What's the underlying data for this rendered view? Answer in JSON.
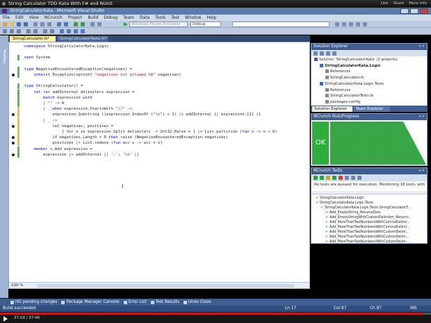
{
  "video": {
    "title": "String Calculator TDD Kata With F# and NUnit",
    "header_right": [
      "Like",
      "Share",
      "More info"
    ],
    "time_current": "37:09",
    "time_total": "37:46",
    "progress": 0.98
  },
  "window": {
    "title": "StringCalculatorKata - Microsoft Visual Studio"
  },
  "menu": [
    "File",
    "Edit",
    "View",
    "NCrunch",
    "Project",
    "Build",
    "Debug",
    "Team",
    "Data",
    "Tools",
    "Test",
    "Window",
    "Help"
  ],
  "toolbar": {
    "emulator": "Windows Phone Emulator",
    "config": "Debug"
  },
  "toolbox_label": "Toolbox",
  "editor": {
    "tabs": [
      {
        "label": "StringCalculator.fs*",
        "active": true
      },
      {
        "label": "StringCalculatorTests.fs*",
        "active": false
      }
    ],
    "zoom": "100 %",
    "lines": [
      {
        "text": "namespace StringCalculatorKata.Logic",
        "change": "none",
        "bp": false
      },
      {
        "text": "",
        "change": "none",
        "bp": false
      },
      {
        "text": "open System",
        "change": "green",
        "bp": false
      },
      {
        "text": "",
        "change": "none",
        "bp": false
      },
      {
        "text": "type NegativeEncounteredException(negatives) =",
        "change": "green",
        "bp": false
      },
      {
        "text": "    inherit Exception(sprintf \"negatives not allowed %A\" negatives)",
        "change": "green",
        "bp": true
      },
      {
        "text": "",
        "change": "none",
        "bp": false
      },
      {
        "text": "type StringCalculator() =",
        "change": "green",
        "bp": false
      },
      {
        "text": "    let rec addInternal delimiters expression =",
        "change": "green",
        "bp": false
      },
      {
        "text": "        match expression with",
        "change": "green",
        "bp": false
      },
      {
        "text": "        | \"\" -> 0",
        "change": "green",
        "bp": false
      },
      {
        "text": "        | _ when expression.StartsWith \"//\" ->",
        "change": "yellow",
        "bp": false
      },
      {
        "text": "            expression.Substring ((expression.IndexOf (\"\\n\") + 1) |> addInternal [| expression.[2] |]",
        "change": "yellow",
        "bp": true
      },
      {
        "text": "        | _ ->",
        "change": "yellow",
        "bp": false
      },
      {
        "text": "            let negatives, positives =",
        "change": "yellow",
        "bp": true
      },
      {
        "text": "                [ for n in expression.Split delimiters -> Int32.Parse n ] |> List.partition (fun n -> n < 0)",
        "change": "yellow",
        "bp": false
      },
      {
        "text": "            if negatives.Length > 0 then raise (NegativeEncounteredException negatives)",
        "change": "yellow",
        "bp": true
      },
      {
        "text": "            positives |> List.reduce (fun acc v -> acc + v)",
        "change": "yellow",
        "bp": true
      },
      {
        "text": "    member x.Add expression =",
        "change": "green",
        "bp": false
      },
      {
        "text": "        expression |> addInternal [| ','; '\\n' |]",
        "change": "green",
        "bp": true
      }
    ]
  },
  "solution_explorer": {
    "title": "Solution Explorer",
    "items": [
      {
        "label": "Solution 'StringCalculatorKata' (2 projects)",
        "level": 0,
        "bold": false
      },
      {
        "label": "StringCalculatorKata.Logic",
        "level": 1,
        "bold": true
      },
      {
        "label": "References",
        "level": 2,
        "bold": false
      },
      {
        "label": "StringCalculator.fs",
        "level": 2,
        "bold": false
      },
      {
        "label": "StringCalculatorKata.Logic.Tests",
        "level": 1,
        "bold": false
      },
      {
        "label": "References",
        "level": 2,
        "bold": false
      },
      {
        "label": "StringCalculatorTests.fs",
        "level": 2,
        "bold": false
      },
      {
        "label": "packages.config",
        "level": 2,
        "bold": false
      }
    ],
    "tabs": [
      "Solution Explorer",
      "Team Explorer"
    ]
  },
  "risk_panel": {
    "title": "NCrunch Risk/Progress",
    "status": "OK",
    "status_color": "#2fad3d"
  },
  "tests_panel": {
    "title": "NCrunch Tests",
    "status_text": "No tests are queued for execution.  Monitoring 18 tests, with no",
    "rows": [
      {
        "label": "StringCalculatorKata.Logic",
        "level": 0
      },
      {
        "label": "StringCalculatorKata.Logic.Tests",
        "level": 0
      },
      {
        "label": "StringCalculatorKata.Logic.Tests.StringCalculatorT...",
        "level": 1
      },
      {
        "label": "Add_EmptyString_ReturnsZero",
        "level": 2
      },
      {
        "label": "Add_EmptyStringWithCustomDelimiter_Returns...",
        "level": 2
      },
      {
        "label": "Add_MoreThanTwoNumbersWithCommaDelimi...",
        "level": 2
      },
      {
        "label": "Add_MoreThanTwoNumbersWithCommaDelimi...",
        "level": 2
      },
      {
        "label": "Add_MoreThanTwoNumbersWithCustomDelim...",
        "level": 2
      },
      {
        "label": "Add_MoreThanTwoNumbersWithCustomDelim...",
        "level": 2
      },
      {
        "label": "Add_MoreThanTwoNumbersWithCustomDelim...",
        "level": 2
      }
    ]
  },
  "bottom_tabs": [
    "HG pending changes",
    "Package Manager Console",
    "Error List",
    "Test Results",
    "Undo Close"
  ],
  "status_bar": {
    "message": "Build succeeded",
    "line": "Ln 17",
    "col": "Col 87",
    "ch": "Ch 87",
    "mode": "INS"
  }
}
